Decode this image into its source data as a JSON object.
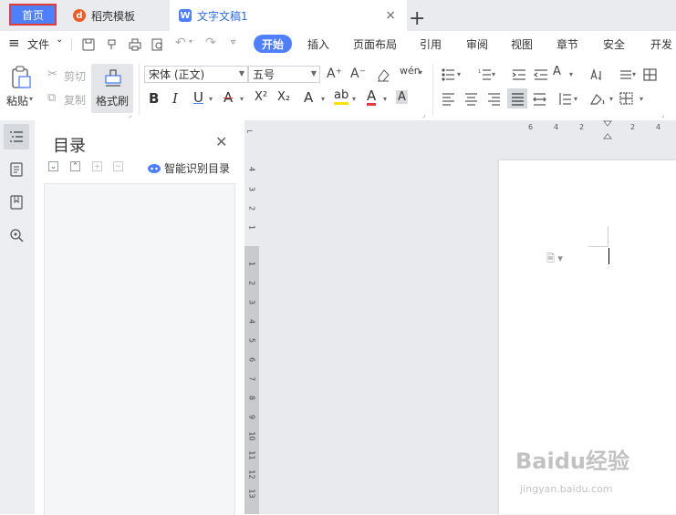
{
  "tabs": {
    "home": "首页",
    "template": "稻壳模板",
    "document": "文字文稿1",
    "add": "+",
    "close": "×"
  },
  "menu": {
    "hamburger": "≡",
    "file": "文件",
    "items": [
      "开始",
      "插入",
      "页面布局",
      "引用",
      "审阅",
      "视图",
      "章节",
      "安全",
      "开发"
    ]
  },
  "ribbon": {
    "paste": "粘贴",
    "cut": "剪切",
    "copy": "复制",
    "format_painter": "格式刷",
    "font_name": "宋体 (正文)",
    "font_size": "五号",
    "bold": "B",
    "italic": "I",
    "underline": "U",
    "strike": "A",
    "superscript": "X²",
    "subscript": "X₂",
    "text_effect": "A",
    "highlight": "ab",
    "font_color": "A",
    "char_shading": "A",
    "grow": "A⁺",
    "shrink": "A⁻",
    "clear": "◇",
    "phonetic": "wén"
  },
  "toc": {
    "title": "目录",
    "smart": "智能识别目录"
  },
  "ruler": {
    "top": [
      "6",
      "4",
      "2",
      "2",
      "4"
    ],
    "left": [
      "4",
      "3",
      "2",
      "1",
      "1",
      "2",
      "3",
      "4",
      "5",
      "6",
      "7",
      "8",
      "9",
      "10",
      "11",
      "12",
      "13"
    ]
  },
  "watermark": {
    "main": "Baidu经验",
    "sub": "jingyan.baidu.com"
  },
  "colors": {
    "accent": "#4d7fff",
    "highlight_border": "#e23b3b",
    "highlight_yellow": "#ffe400",
    "font_color_red": "#e23b3b"
  }
}
